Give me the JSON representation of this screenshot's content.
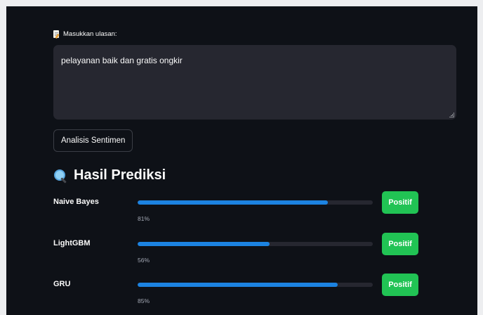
{
  "review_input": {
    "label": "Masukkan ulasan:",
    "label_icon": "memo-icon",
    "value": "pelayanan baik dan gratis ongkir"
  },
  "analyze_button": {
    "label": "Analisis Sentimen"
  },
  "results": {
    "title": "Hasil Prediksi",
    "title_icon": "magnifying-glass-icon",
    "accent_color": "#1c83e1",
    "badge_color": "#21c354",
    "models": [
      {
        "name": "Naive Bayes",
        "confidence": 0.81,
        "confidence_label": "81%",
        "prediction": "Positif"
      },
      {
        "name": "LightGBM",
        "confidence": 0.56,
        "confidence_label": "56%",
        "prediction": "Positif"
      },
      {
        "name": "GRU",
        "confidence": 0.85,
        "confidence_label": "85%",
        "prediction": "Positif"
      }
    ]
  }
}
